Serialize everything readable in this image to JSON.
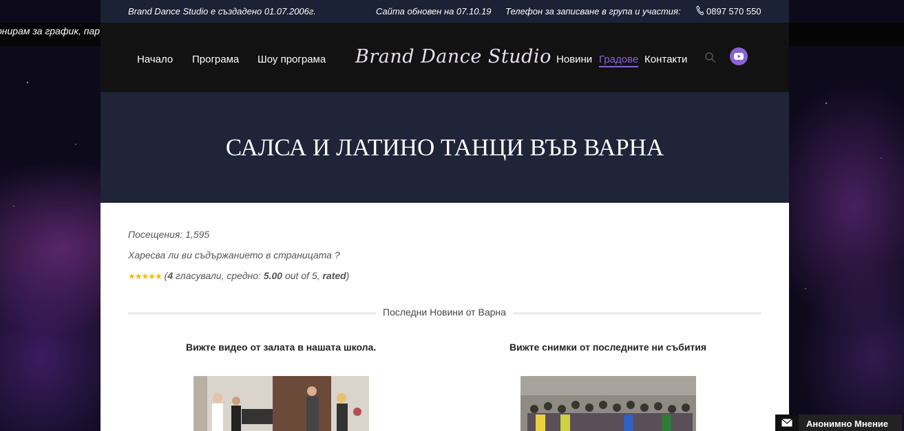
{
  "marquee": "онирам за график, пар",
  "topbar": {
    "founded": "Brand Dance Studio е създадено 01.07.2006г.",
    "updated": "Сайта обновен на 07.10.19",
    "phone_label": "Телефон за записване в група и участия:",
    "phone": "0897 570 550"
  },
  "nav": {
    "home": "Начало",
    "schedule": "Програма",
    "show": "Шоу програма",
    "logo": "Brand Dance Studio",
    "news": "Новини",
    "cities": "Градове",
    "contacts": "Контакти"
  },
  "hero": {
    "title": "САЛСА И ЛАТИНО ТАНЦИ ВЪВ ВАРНА"
  },
  "stats": {
    "visits": "Посещения: 1,595",
    "question": "Харесва ли ви съдържанието в страницата ?",
    "stars": "★★★★★",
    "rating_open": " (",
    "votes": "4",
    "rating_mid": " гласували, средно: ",
    "average": "5.00",
    "rating_outof": " out of 5, ",
    "rated": "rated",
    "rating_close": ")"
  },
  "section": {
    "label": "Последни Новини от Варна"
  },
  "columns": {
    "left_title": "Вижте видео от залата в нашата школа.",
    "right_title": "Вижте снимки от последните ни събития"
  },
  "feedback": {
    "label": "Анонимно Мнение"
  },
  "colors": {
    "accent": "#8a63d2",
    "header_bg": "#1b2235",
    "nav_bg": "#121212"
  }
}
